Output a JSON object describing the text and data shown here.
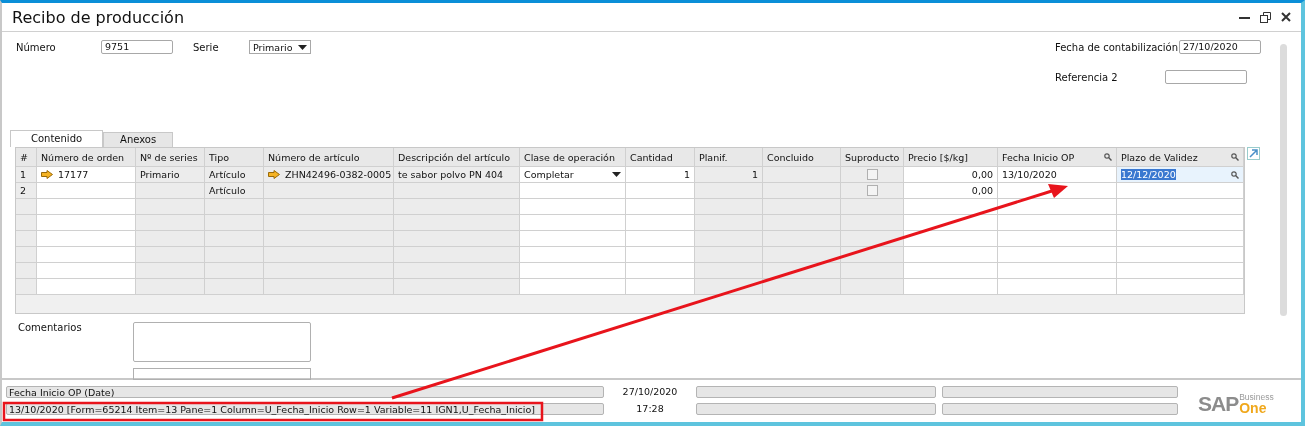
{
  "window": {
    "title": "Recibo de producción"
  },
  "header": {
    "number_label": "Número",
    "number": "9751",
    "series_label": "Serie",
    "series": "Primario",
    "posting_date_label": "Fecha de contabilización",
    "posting_date": "27/10/2020",
    "ref2_label": "Referencia 2"
  },
  "tabs": [
    {
      "label": "Contenido",
      "selected": true
    },
    {
      "label": "Anexos",
      "selected": false
    }
  ],
  "table": {
    "columns": [
      "#",
      "Número de orden",
      "Nº de series",
      "Tipo",
      "Número de artículo",
      "Descripción del artículo",
      "Clase de operación",
      "Cantidad",
      "Planif.",
      "Concluido",
      "Suproducto",
      "Precio [$/kg]",
      "Fecha Inicio OP",
      "Plazo de Validez"
    ],
    "rows": [
      {
        "row_number": "1",
        "order_number": "17177",
        "order_link": true,
        "series": "Primario",
        "type": "Artículo",
        "item_number": "ZHN42496-0382-0005",
        "item_link": true,
        "description": "te sabor polvo PN 404",
        "operation": "Completar",
        "quantity": "1",
        "planned": "1",
        "byproduct": false,
        "price": "0,00",
        "start_date": "13/10/2020",
        "validity": "12/12/2020",
        "validity_selected": true
      },
      {
        "row_number": "2",
        "type": "Artículo",
        "byproduct": false,
        "price": "0,00"
      }
    ]
  },
  "comments_label": "Comentarios",
  "status_bar": {
    "message": "Fecha Inicio OP (Date)",
    "date": "27/10/2020",
    "detail": "13/10/2020 [Form=65214 Item=13 Pane=1 Column=U_Fecha_Inicio Row=1 Variable=11 IGN1,U_Fecha_Inicio]",
    "time": "17:28"
  },
  "logo": {
    "brand": "SAP",
    "line1": "Business",
    "line2": "One"
  }
}
